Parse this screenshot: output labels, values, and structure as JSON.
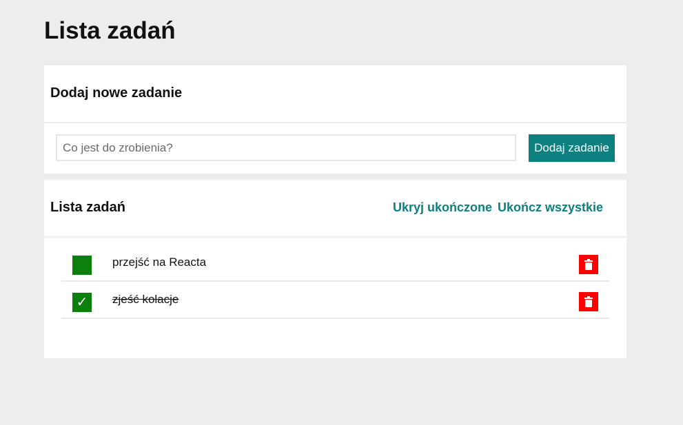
{
  "page": {
    "title": "Lista zadań"
  },
  "add_card": {
    "title": "Dodaj nowe zadanie",
    "input_placeholder": "Co jest do zrobienia?",
    "input_value": "",
    "add_button_label": "Dodaj zadanie"
  },
  "list_card": {
    "title": "Lista zadań",
    "hide_completed_label": "Ukryj ukończone",
    "complete_all_label": "Ukończ wszystkie"
  },
  "tasks": [
    {
      "text": "przejść na Reacta",
      "completed": false,
      "check_mark": ""
    },
    {
      "text": "zjeść kolacje",
      "completed": true,
      "check_mark": "✓"
    }
  ],
  "colors": {
    "background": "#ededed",
    "card": "#ffffff",
    "accent": "#0d8080",
    "checkbox": "#0c7f0c",
    "delete": "#ff0000"
  },
  "icons": {
    "checkbox": "check-icon",
    "delete": "trash-icon"
  }
}
